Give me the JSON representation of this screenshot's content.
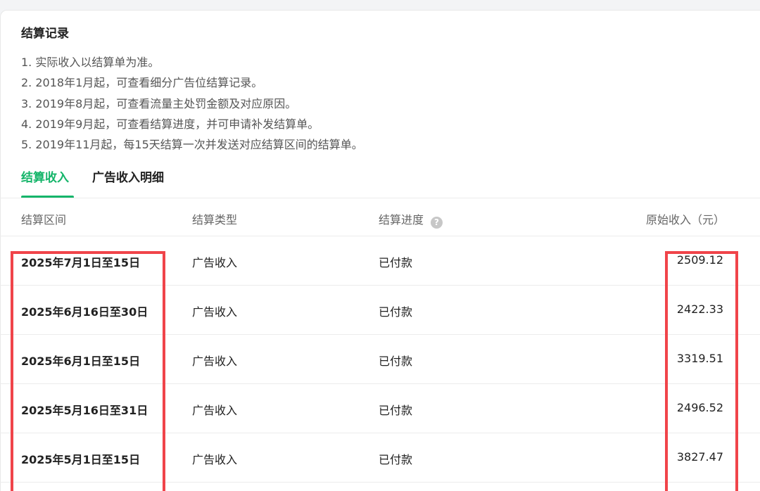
{
  "section": {
    "title": "结算记录",
    "notes": [
      "1. 实际收入以结算单为准。",
      "2. 2018年1月起，可查看细分广告位结算记录。",
      "3. 2019年8月起，可查看流量主处罚金额及对应原因。",
      "4. 2019年9月起，可查看结算进度，并可申请补发结算单。",
      "5. 2019年11月起，每15天结算一次并发送对应结算区间的结算单。"
    ]
  },
  "tabs": [
    {
      "label": "结算收入",
      "active": true
    },
    {
      "label": "广告收入明细",
      "active": false
    }
  ],
  "table": {
    "headers": {
      "period": "结算区间",
      "type": "结算类型",
      "progress": "结算进度",
      "income": "原始收入（元）"
    },
    "help_icon": "question-circle-icon",
    "rows": [
      {
        "period": "2025年7月1日至15日",
        "type": "广告收入",
        "progress": "已付款",
        "income": "2509.12"
      },
      {
        "period": "2025年6月16日至30日",
        "type": "广告收入",
        "progress": "已付款",
        "income": "2422.33"
      },
      {
        "period": "2025年6月1日至15日",
        "type": "广告收入",
        "progress": "已付款",
        "income": "3319.51"
      },
      {
        "period": "2025年5月16日至31日",
        "type": "广告收入",
        "progress": "已付款",
        "income": "2496.52"
      },
      {
        "period": "2025年5月1日至15日",
        "type": "广告收入",
        "progress": "已付款",
        "income": "3827.47"
      }
    ]
  },
  "colors": {
    "accent": "#15b56a",
    "highlight": "#f0444a"
  }
}
